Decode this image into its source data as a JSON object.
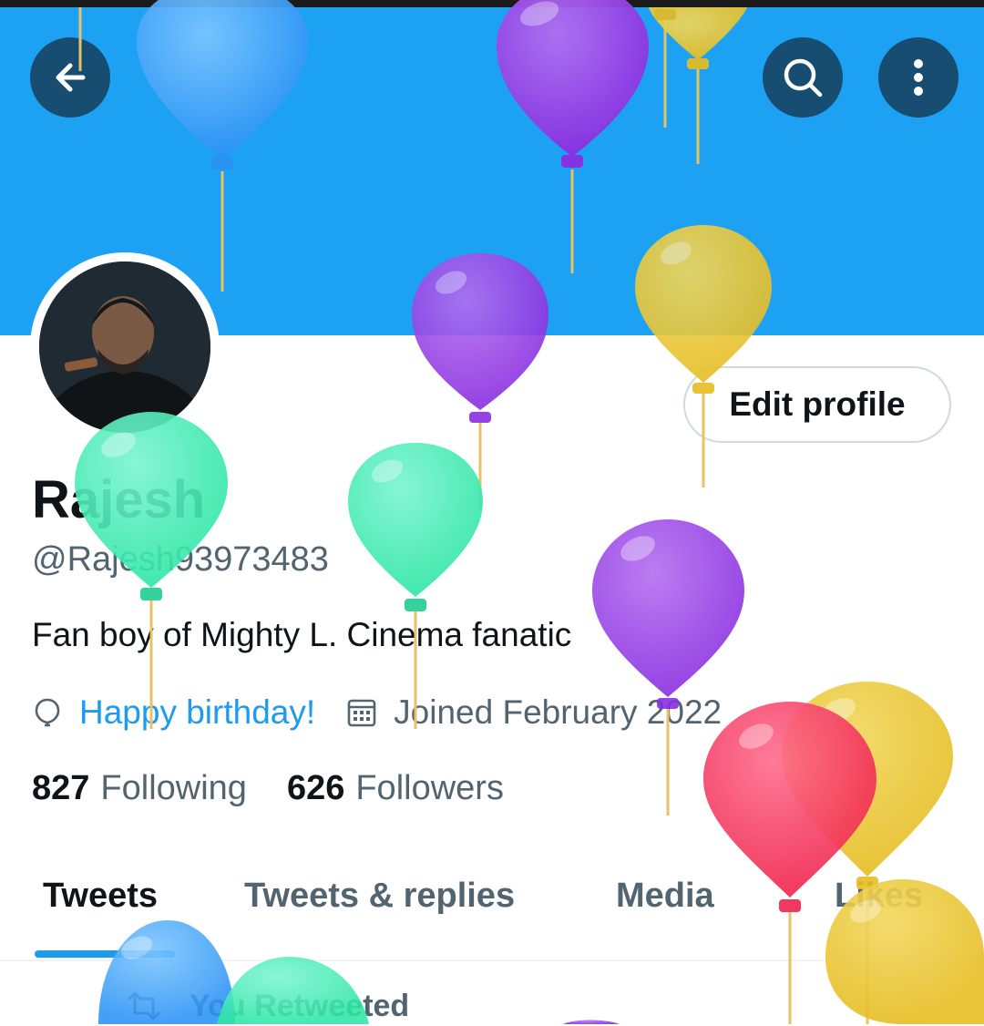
{
  "profile": {
    "name": "Rajesh",
    "handle": "@Rajesh93973483",
    "bio": "Fan boy of Mighty L.  Cinema fanatic",
    "birthday_text": "Happy birthday!",
    "joined_text": "Joined February 2022",
    "following_count": "827",
    "following_label": "Following",
    "followers_count": "626",
    "followers_label": "Followers"
  },
  "header": {
    "back_icon": "arrow-left-icon",
    "search_icon": "search-icon",
    "more_icon": "more-vertical-icon",
    "banner_color": "#1da1f2"
  },
  "actions": {
    "edit_profile_label": "Edit profile"
  },
  "tabs": [
    {
      "label": "Tweets",
      "active": true
    },
    {
      "label": "Tweets & replies",
      "active": false
    },
    {
      "label": "Media",
      "active": false
    },
    {
      "label": "Likes",
      "active": false
    }
  ],
  "feed": {
    "retweet_label": "You Retweeted"
  },
  "colors": {
    "accent": "#1d9bf0",
    "secondary_text": "#536471",
    "primary_text": "#0f1419"
  }
}
